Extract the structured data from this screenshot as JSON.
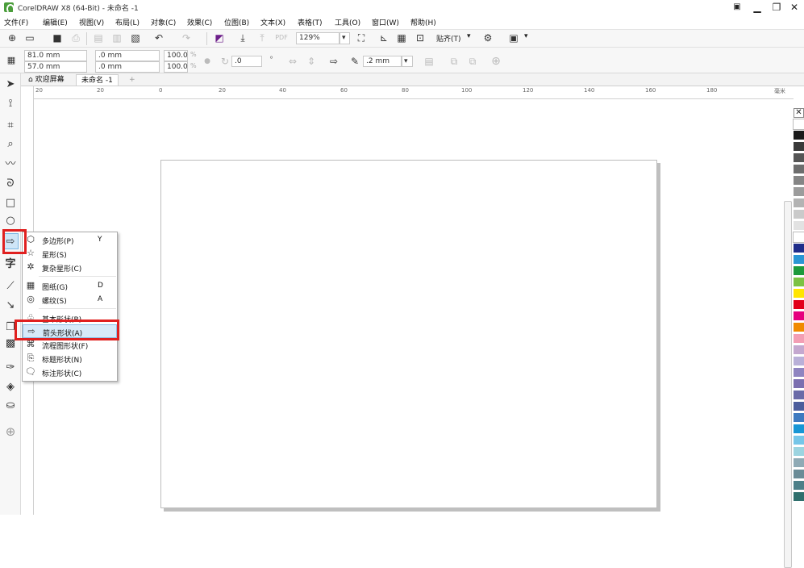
{
  "app": {
    "title": "CorelDRAW X8 (64-Bit) - 未命名 -1"
  },
  "window_buttons": {
    "minimize": "▁",
    "restore": "❐",
    "close": "✕"
  },
  "menu": [
    "文件(F)",
    "编辑(E)",
    "视图(V)",
    "布局(L)",
    "对象(C)",
    "效果(C)",
    "位图(B)",
    "文本(X)",
    "表格(T)",
    "工具(O)",
    "窗口(W)",
    "帮助(H)"
  ],
  "toolbar": {
    "zoom": "129%",
    "snap_label": "贴齐(T)",
    "zoom_dropdown": "▾"
  },
  "props": {
    "x": "81.0 mm",
    "y": "57.0 mm",
    "w": ".0 mm",
    "h": ".0 mm",
    "sx": "100.0",
    "sy": "100.0",
    "pct": "%",
    "angle": ".0",
    "angle_unit": "°",
    "outline": ".2 mm"
  },
  "tabs": {
    "welcome": "欢迎屏幕",
    "doc": "未命名 -1",
    "add": "+"
  },
  "ruler": {
    "top": [
      "20",
      "20",
      "0",
      "20",
      "40",
      "60",
      "80",
      "100",
      "120",
      "140",
      "160",
      "180"
    ],
    "unit": "毫米"
  },
  "flyout": [
    {
      "icon": "polygon-icon",
      "glyph": "⬡",
      "label": "多边形(P)",
      "shortcut": "Y"
    },
    {
      "icon": "star-icon",
      "glyph": "☆",
      "label": "星形(S)",
      "shortcut": ""
    },
    {
      "icon": "complex-star-icon",
      "glyph": "✲",
      "label": "复杂星形(C)",
      "shortcut": ""
    },
    {
      "icon": "graph-paper-icon",
      "glyph": "▦",
      "label": "图纸(G)",
      "shortcut": "D"
    },
    {
      "icon": "spiral-icon",
      "glyph": "◎",
      "label": "螺纹(S)",
      "shortcut": "A"
    },
    {
      "icon": "basic-shapes-icon",
      "glyph": "♧",
      "label": "基本形状(B)",
      "shortcut": ""
    },
    {
      "icon": "arrow-shapes-icon",
      "glyph": "⇨",
      "label": "箭头形状(A)",
      "shortcut": ""
    },
    {
      "icon": "flowchart-shapes-icon",
      "glyph": "⌘",
      "label": "流程图形状(F)",
      "shortcut": ""
    },
    {
      "icon": "banner-shapes-icon",
      "glyph": "⎘",
      "label": "标题形状(N)",
      "shortcut": ""
    },
    {
      "icon": "callout-shapes-icon",
      "glyph": "🗨",
      "label": "标注形状(C)",
      "shortcut": ""
    }
  ],
  "colors": {
    "highlight": "#e0201f",
    "selection": "#cfe6f7"
  },
  "palette": [
    "#ffffff",
    "#1a1a1a",
    "#3a3a3a",
    "#555555",
    "#6d6d6d",
    "#858585",
    "#9c9c9c",
    "#b3b3b3",
    "#cacaca",
    "#e2e2e2",
    "#ffffff",
    "#1f2d8a",
    "#2a96d4",
    "#1c9a3b",
    "#7cc243",
    "#ffe500",
    "#e2001a",
    "#e5007e",
    "#f08a00",
    "#f39eb4",
    "#c4a8cf",
    "#b9b0d8",
    "#8f84c0",
    "#7c6fb0",
    "#6a6aa8",
    "#4c5d9c",
    "#3e7ac0",
    "#1796d5",
    "#76c6e8",
    "#9cd4e0",
    "#8faab5",
    "#6b8c97",
    "#4d7f88",
    "#2f6f6d"
  ]
}
